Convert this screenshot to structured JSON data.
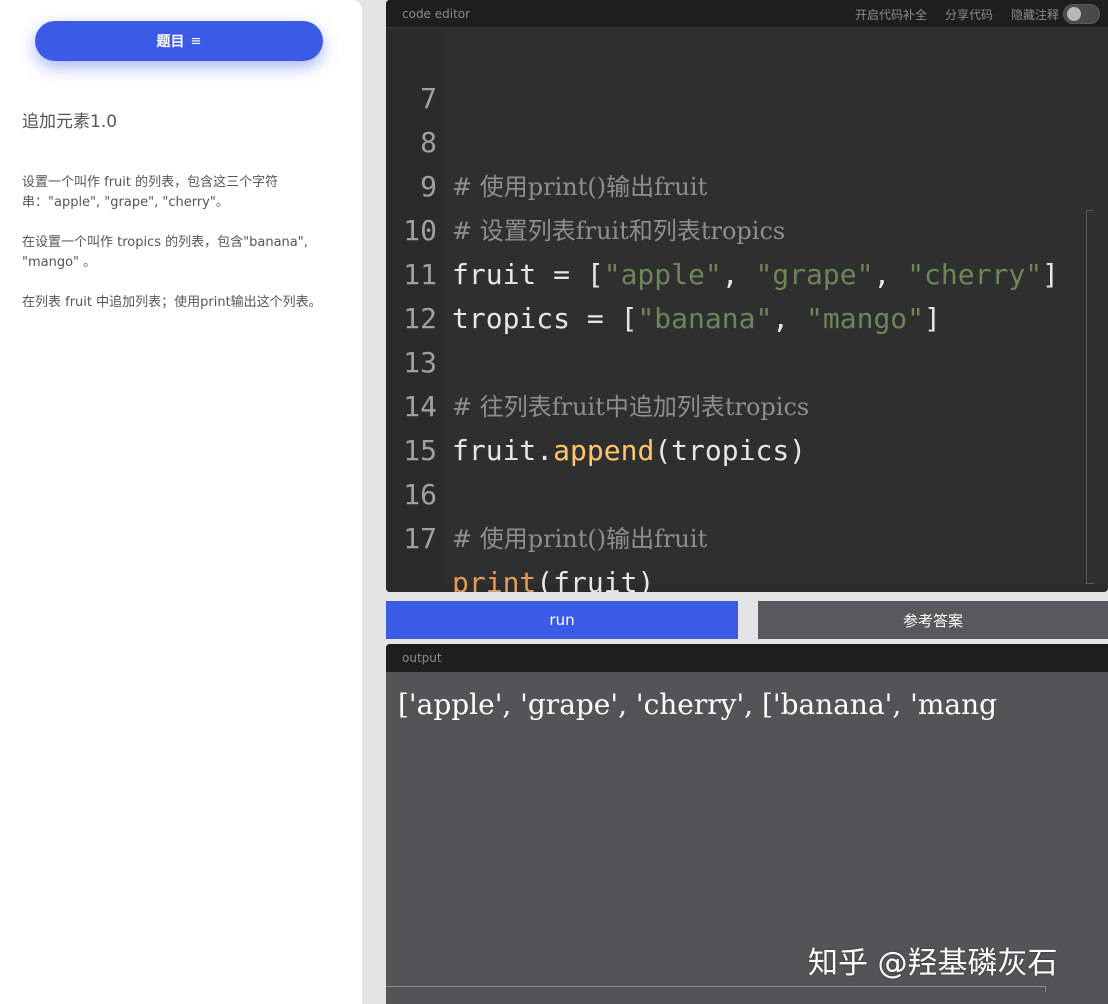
{
  "sidebar": {
    "topic_button": "题目",
    "topic_icon": "≡",
    "task_title": "追加元素1.0",
    "description": [
      "设置一个叫作 fruit 的列表，包含这三个字符串：\"apple\", \"grape\", \"cherry\"。",
      "在设置一个叫作 tropics 的列表，包含\"banana\", \"mango\" 。",
      "在列表 fruit 中追加列表；使用print输出这个列表。"
    ]
  },
  "editor": {
    "title": "code editor",
    "actions": {
      "autocomplete": "开启代码补全",
      "share": "分享代码",
      "hide_comments": "隐藏注释"
    },
    "lines": [
      {
        "num": "7"
      },
      {
        "num": "8",
        "comment": "# 使用print()输出fruit"
      },
      {
        "num": "9",
        "comment": "# 设置列表fruit和列表tropics"
      },
      {
        "num": "10",
        "a": "fruit = [",
        "s1": "\"apple\"",
        "c1": ", ",
        "s2": "\"grape\"",
        "c2": ", ",
        "s3": "\"cherry\"",
        "e": "]"
      },
      {
        "num": "11",
        "a": "tropics = [",
        "s1": "\"banana\"",
        "c1": ", ",
        "s2": "\"mango\"",
        "e": "]"
      },
      {
        "num": "12"
      },
      {
        "num": "13",
        "comment": "# 往列表fruit中追加列表tropics"
      },
      {
        "num": "14",
        "a": "fruit.",
        "fn": "append",
        "e": "(tropics)"
      },
      {
        "num": "15"
      },
      {
        "num": "16",
        "comment": "# 使用print()输出fruit"
      },
      {
        "num": "17",
        "kw": "print",
        "e": "(fruit)"
      }
    ]
  },
  "buttons": {
    "run": "run",
    "answer": "参考答案"
  },
  "output": {
    "title": "output",
    "text": "['apple', 'grape', 'cherry', ['banana', 'mang"
  },
  "watermark": "知乎 @羟基磷灰石",
  "colors": {
    "accent": "#3b5be6",
    "string": "#6a8759",
    "function": "#ffc66d",
    "keyword": "#e39a5a",
    "comment": "#8e8e8e"
  }
}
